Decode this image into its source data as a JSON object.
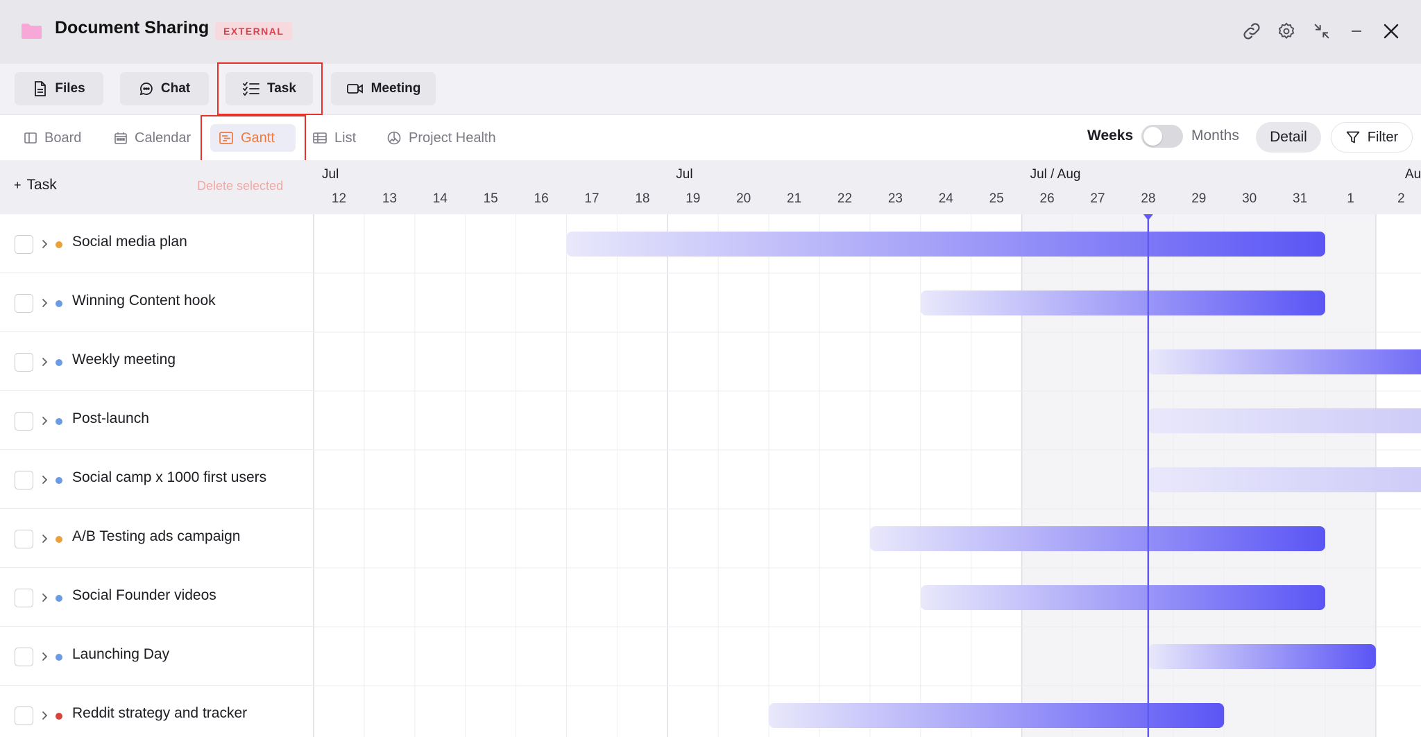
{
  "window": {
    "title": "Document Sharing",
    "badge": "EXTERNAL",
    "icons": [
      "link-icon",
      "gear-icon",
      "collapse-icon",
      "minimize-icon",
      "close-icon"
    ],
    "folder_color": "#f7a8d8"
  },
  "main_tabs": [
    {
      "label": "Files",
      "icon": "file-icon"
    },
    {
      "label": "Chat",
      "icon": "chat-icon"
    },
    {
      "label": "Task",
      "icon": "checklist-icon",
      "selected": true
    },
    {
      "label": "Meeting",
      "icon": "video-icon"
    }
  ],
  "view_tabs": [
    {
      "label": "Board",
      "icon": "board-icon"
    },
    {
      "label": "Calendar",
      "icon": "calendar-icon"
    },
    {
      "label": "Gantt",
      "icon": "gantt-icon",
      "active": true
    },
    {
      "label": "List",
      "icon": "list-icon"
    },
    {
      "label": "Project Health",
      "icon": "health-icon"
    }
  ],
  "scale": {
    "left_label": "Weeks",
    "right_label": "Months",
    "months_enabled": false
  },
  "detail_label": "Detail",
  "filter_label": "Filter",
  "task_header": {
    "add_label": "Task",
    "add_symbol": "+",
    "delete_label": "Delete selected"
  },
  "colors": {
    "accent": "#6159f5",
    "bar_start": "#e9e8fb",
    "bar_end": "#5b55f5",
    "orange": "#e9a13b",
    "blue": "#6b9be0",
    "red": "#d7443e",
    "active_tab": "#f0783a"
  },
  "chart_data": {
    "type": "gantt",
    "months": [
      {
        "label": "Jul",
        "day_index": 0
      },
      {
        "label": "Jul",
        "day_index": 7
      },
      {
        "label": "Jul / Aug",
        "day_index": 14
      },
      {
        "label": "Aug",
        "day_index": 21
      }
    ],
    "days": [
      "12",
      "13",
      "14",
      "15",
      "16",
      "17",
      "18",
      "19",
      "20",
      "21",
      "22",
      "23",
      "24",
      "25",
      "26",
      "27",
      "28",
      "29",
      "30",
      "31",
      "1",
      "2"
    ],
    "weekend_range": [
      14,
      21
    ],
    "today_index": 16.5,
    "tasks": [
      {
        "name": "Social media plan",
        "status": "orange",
        "start": 5,
        "end": 20
      },
      {
        "name": "Winning Content hook",
        "status": "blue",
        "start": 12,
        "end": 20
      },
      {
        "name": "Weekly meeting",
        "status": "blue",
        "start": 16.5,
        "end": 23
      },
      {
        "name": "Post-launch",
        "status": "blue",
        "start": 16.5,
        "end": 23,
        "pale": true
      },
      {
        "name": "Social camp x 1000 first users",
        "status": "blue",
        "start": 16.5,
        "end": 23,
        "pale": true
      },
      {
        "name": "A/B Testing ads campaign",
        "status": "orange",
        "start": 11,
        "end": 20
      },
      {
        "name": "Social Founder videos",
        "status": "blue",
        "start": 12,
        "end": 20
      },
      {
        "name": "Launching Day",
        "status": "blue",
        "start": 16.5,
        "end": 21
      },
      {
        "name": "Reddit strategy and tracker",
        "status": "red",
        "start": 9,
        "end": 18
      }
    ]
  }
}
